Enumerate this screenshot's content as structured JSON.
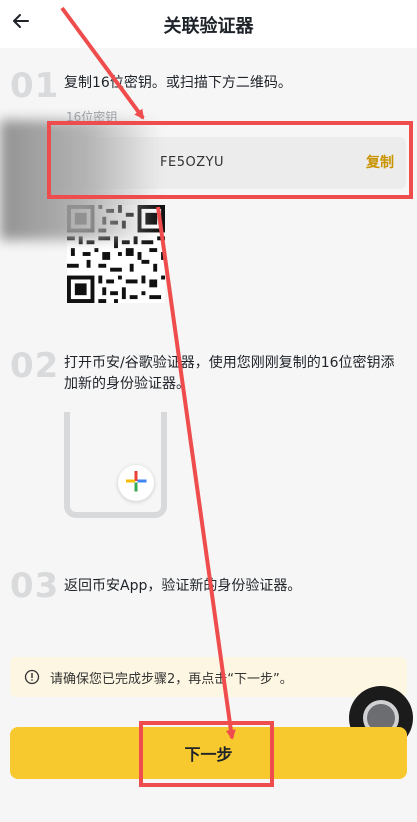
{
  "header": {
    "title": "关联验证器",
    "back_icon": "arrow-left-icon"
  },
  "steps": [
    {
      "num": "01",
      "text": "复制16位密钥。或扫描下方二维码。"
    },
    {
      "num": "02",
      "text": "打开币安/谷歌验证器，使用您刚刚复制的16位密钥添加新的身份验证器。"
    },
    {
      "num": "03",
      "text": "返回币安App，验证新的身份验证器。"
    }
  ],
  "key": {
    "label": "16位密钥",
    "value": "FE5OZYU",
    "copy_label": "复制"
  },
  "notice": {
    "text": "请确保您已完成步骤2，再点击“下一步”。",
    "icon": "info-circle-icon"
  },
  "next_label": "下一步",
  "colors": {
    "accent": "#f7c92f",
    "copy": "#c99400",
    "annotation": "#ef4d4d"
  }
}
